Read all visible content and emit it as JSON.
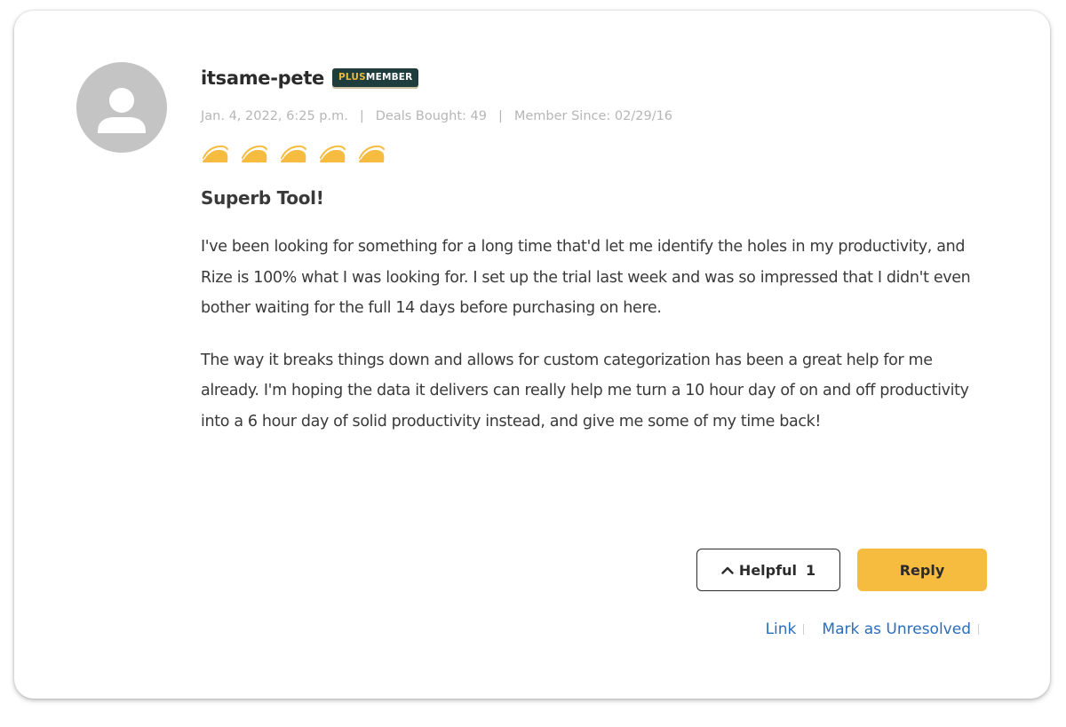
{
  "review": {
    "avatar_icon": "user-silhouette-icon",
    "username": "itsame-pete",
    "badge": {
      "plus": "PLUS",
      "member": "MEMBER"
    },
    "meta": {
      "date": "Jan. 4, 2022, 6:25 p.m.",
      "separator": "|",
      "deals_bought": "Deals Bought: 49",
      "member_since": "Member Since: 02/29/16"
    },
    "rating": {
      "value": 5,
      "max": 5,
      "icon": "taco-icon",
      "color": "#f5bc3f"
    },
    "title": "Superb Tool!",
    "paragraphs": [
      "I've been looking for something for a long time that'd let me identify the holes in my productivity, and Rize is 100% what I was looking for. I set up the trial last week and was so impressed that I didn't even bother waiting for the full 14 days before purchasing on here.",
      "The way it breaks things down and allows for custom categorization has been a great help for me already. I'm hoping the data it delivers can really help me turn a 10 hour day of on and off productivity into a 6 hour day of solid productivity instead, and give me some of my time back!"
    ]
  },
  "actions": {
    "helpful_label": "Helpful",
    "helpful_count": "1",
    "reply_label": "Reply",
    "link_label": "Link",
    "unresolve_label": "Mark as Unresolved"
  },
  "colors": {
    "accent": "#f5bc3f",
    "link": "#2a6ebb",
    "badge_bg": "#1f3d3d",
    "badge_plus": "#e9b93c"
  }
}
